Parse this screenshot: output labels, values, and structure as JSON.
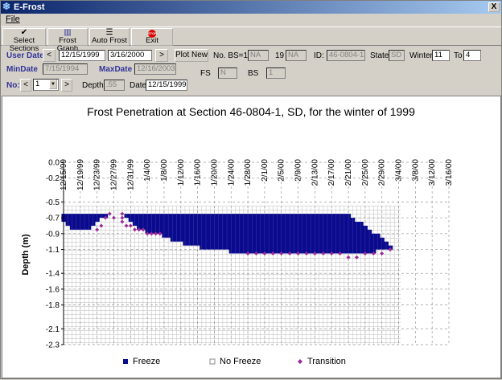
{
  "window": {
    "title": "E-Frost",
    "close_glyph": "X"
  },
  "menu": {
    "file": "File"
  },
  "toolbar": {
    "select_sections": "Select Sections",
    "frost_graph": "Frost Graph",
    "auto_frost": "Auto Frost",
    "exit": "Exit",
    "exit_icon_text": "STOP"
  },
  "controls": {
    "user_date_label": "User Date",
    "user_date_start": "12/15/1999",
    "user_date_end": "3/16/2000",
    "prev_glyph": "<",
    "next_glyph": ">",
    "plot_new": "Plot New",
    "no_bs_label": "No. BS=11",
    "no_bs_value": "NA",
    "count_label": "19",
    "count_value": "NA",
    "id_label": "ID:",
    "id_value": "46-0804-1",
    "state_label": "State",
    "state_value": "SD",
    "winter_label": "Winter",
    "winter_value": "11",
    "to_label": "To",
    "to_value": "4",
    "min_date_label": "MinDate",
    "min_date_value": "7/15/1994",
    "max_date_label": "MaxDate",
    "max_date_value": "12/16/2003",
    "fs_label": "FS",
    "fs_value": "N",
    "bs_label": "BS",
    "bs_value": "1",
    "no_label": "No:",
    "no_value": "1",
    "depth_label": "Depth",
    "depth_value": ".55",
    "date_label": "Date",
    "date_value": "12/15/1999"
  },
  "chart_data": {
    "type": "heatmap",
    "title": "Frost Penetration at Section 46-0804-1, SD, for the winter of 1999",
    "ylabel": "Depth (m)",
    "xlabel": "",
    "x_ticks": [
      "12/15/99",
      "12/19/99",
      "12/23/99",
      "12/27/99",
      "12/31/99",
      "1/4/00",
      "1/8/00",
      "1/12/00",
      "1/16/00",
      "1/20/00",
      "1/24/00",
      "1/28/00",
      "2/1/00",
      "2/5/00",
      "2/9/00",
      "2/13/00",
      "2/17/00",
      "2/21/00",
      "2/25/00",
      "2/29/00",
      "3/4/00",
      "3/8/00",
      "3/12/00",
      "3/16/00"
    ],
    "y_ticks": [
      "0.0",
      "-0.2",
      "-0.5",
      "-0.7",
      "-0.9",
      "-1.1",
      "-1.4",
      "-1.6",
      "-1.8",
      "-2.1",
      "-2.3"
    ],
    "ylim": [
      -2.3,
      0
    ],
    "grid": true,
    "legend_position": "bottom",
    "legend": [
      "Freeze",
      "No Freeze",
      "Transition"
    ],
    "colors": {
      "freeze": "#0a0a8c",
      "nofreeze": "#ffffff",
      "transition": "#9b2a9b",
      "grid": "#808080"
    },
    "series": [
      {
        "name": "Freeze",
        "points": [
          [
            "12/15/99",
            -0.65,
            -0.75
          ],
          [
            "12/16/99",
            -0.65,
            -0.8
          ],
          [
            "12/17/99",
            -0.65,
            -0.85
          ],
          [
            "12/18/99",
            -0.65,
            -0.85
          ],
          [
            "12/19/99",
            -0.65,
            -0.85
          ],
          [
            "12/20/99",
            -0.65,
            -0.85
          ],
          [
            "12/21/99",
            -0.65,
            -0.85
          ],
          [
            "12/22/99",
            -0.65,
            -0.8
          ],
          [
            "12/23/99",
            -0.65,
            -0.75
          ],
          [
            "12/24/99",
            -0.65,
            -0.7
          ],
          [
            "12/25/99",
            -0.65,
            -0.7
          ],
          [
            "12/26/99",
            -0.65,
            -0.65
          ],
          [
            "12/27/99",
            -0.65,
            -0.65
          ],
          [
            "12/28/99",
            -0.65,
            -0.65
          ],
          [
            "12/29/99",
            -0.65,
            -0.65
          ],
          [
            "12/30/99",
            -0.65,
            -0.7
          ],
          [
            "12/31/99",
            -0.65,
            -0.75
          ],
          [
            "1/1/00",
            -0.65,
            -0.8
          ],
          [
            "1/2/00",
            -0.65,
            -0.85
          ],
          [
            "1/3/00",
            -0.65,
            -0.85
          ],
          [
            "1/4/00",
            -0.65,
            -0.9
          ],
          [
            "1/5/00",
            -0.65,
            -0.9
          ],
          [
            "1/6/00",
            -0.65,
            -0.9
          ],
          [
            "1/7/00",
            -0.65,
            -0.9
          ],
          [
            "1/8/00",
            -0.65,
            -0.95
          ],
          [
            "1/9/00",
            -0.65,
            -0.95
          ],
          [
            "1/10/00",
            -0.65,
            -1.0
          ],
          [
            "1/11/00",
            -0.65,
            -1.0
          ],
          [
            "1/12/00",
            -0.65,
            -1.0
          ],
          [
            "1/13/00",
            -0.65,
            -1.05
          ],
          [
            "1/14/00",
            -0.65,
            -1.05
          ],
          [
            "1/15/00",
            -0.65,
            -1.05
          ],
          [
            "1/16/00",
            -0.65,
            -1.05
          ],
          [
            "1/17/00",
            -0.65,
            -1.1
          ],
          [
            "1/18/00",
            -0.65,
            -1.1
          ],
          [
            "1/19/00",
            -0.65,
            -1.1
          ],
          [
            "1/20/00",
            -0.65,
            -1.1
          ],
          [
            "1/21/00",
            -0.65,
            -1.1
          ],
          [
            "1/22/00",
            -0.65,
            -1.1
          ],
          [
            "1/23/00",
            -0.65,
            -1.1
          ],
          [
            "1/24/00",
            -0.65,
            -1.15
          ],
          [
            "1/25/00",
            -0.65,
            -1.15
          ],
          [
            "1/26/00",
            -0.65,
            -1.15
          ],
          [
            "1/27/00",
            -0.65,
            -1.15
          ],
          [
            "1/28/00",
            -0.65,
            -1.15
          ],
          [
            "1/29/00",
            -0.65,
            -1.15
          ],
          [
            "1/30/00",
            -0.65,
            -1.15
          ],
          [
            "1/31/00",
            -0.65,
            -1.15
          ],
          [
            "2/1/00",
            -0.65,
            -1.15
          ],
          [
            "2/2/00",
            -0.65,
            -1.15
          ],
          [
            "2/3/00",
            -0.65,
            -1.15
          ],
          [
            "2/4/00",
            -0.65,
            -1.15
          ],
          [
            "2/5/00",
            -0.65,
            -1.15
          ],
          [
            "2/6/00",
            -0.65,
            -1.15
          ],
          [
            "2/7/00",
            -0.65,
            -1.15
          ],
          [
            "2/8/00",
            -0.65,
            -1.15
          ],
          [
            "2/9/00",
            -0.65,
            -1.15
          ],
          [
            "2/10/00",
            -0.65,
            -1.15
          ],
          [
            "2/11/00",
            -0.65,
            -1.15
          ],
          [
            "2/12/00",
            -0.65,
            -1.15
          ],
          [
            "2/13/00",
            -0.65,
            -1.15
          ],
          [
            "2/14/00",
            -0.65,
            -1.15
          ],
          [
            "2/15/00",
            -0.65,
            -1.15
          ],
          [
            "2/16/00",
            -0.65,
            -1.15
          ],
          [
            "2/17/00",
            -0.65,
            -1.15
          ],
          [
            "2/18/00",
            -0.65,
            -1.15
          ],
          [
            "2/19/00",
            -0.65,
            -1.15
          ],
          [
            "2/20/00",
            -0.65,
            -1.15
          ],
          [
            "2/21/00",
            -0.65,
            -1.15
          ],
          [
            "2/22/00",
            -0.7,
            -1.15
          ],
          [
            "2/23/00",
            -0.75,
            -1.15
          ],
          [
            "2/24/00",
            -0.75,
            -1.15
          ],
          [
            "2/25/00",
            -0.8,
            -1.15
          ],
          [
            "2/26/00",
            -0.85,
            -1.15
          ],
          [
            "2/27/00",
            -0.9,
            -1.15
          ],
          [
            "2/28/00",
            -0.9,
            -1.1
          ],
          [
            "2/29/00",
            -0.95,
            -1.1
          ],
          [
            "3/1/00",
            -1.0,
            -1.1
          ],
          [
            "3/2/00",
            -1.05,
            -1.1
          ]
        ]
      },
      {
        "name": "Transition",
        "points": [
          [
            "12/23/99",
            -0.85
          ],
          [
            "12/24/99",
            -0.8
          ],
          [
            "12/25/99",
            -0.7
          ],
          [
            "12/26/99",
            -0.65
          ],
          [
            "12/27/99",
            -0.7
          ],
          [
            "12/29/99",
            -0.65
          ],
          [
            "12/29/99",
            -0.7
          ],
          [
            "12/29/99",
            -0.75
          ],
          [
            "12/30/99",
            -0.8
          ],
          [
            "12/31/99",
            -0.8
          ],
          [
            "1/1/00",
            -0.85
          ],
          [
            "1/2/00",
            -0.85
          ],
          [
            "1/3/00",
            -0.85
          ],
          [
            "1/4/00",
            -0.9
          ],
          [
            "1/5/00",
            -0.9
          ],
          [
            "1/6/00",
            -0.9
          ],
          [
            "1/7/00",
            -0.9
          ],
          [
            "1/28/00",
            -1.15
          ],
          [
            "1/30/00",
            -1.15
          ],
          [
            "2/1/00",
            -1.15
          ],
          [
            "2/3/00",
            -1.15
          ],
          [
            "2/5/00",
            -1.15
          ],
          [
            "2/7/00",
            -1.15
          ],
          [
            "2/9/00",
            -1.15
          ],
          [
            "2/11/00",
            -1.15
          ],
          [
            "2/13/00",
            -1.15
          ],
          [
            "2/15/00",
            -1.15
          ],
          [
            "2/17/00",
            -1.15
          ],
          [
            "2/19/00",
            -1.15
          ],
          [
            "2/21/00",
            -1.2
          ],
          [
            "2/23/00",
            -1.2
          ],
          [
            "2/25/00",
            -1.15
          ],
          [
            "2/27/00",
            -1.15
          ],
          [
            "2/29/00",
            -1.15
          ],
          [
            "3/2/00",
            -1.1
          ]
        ]
      }
    ]
  }
}
